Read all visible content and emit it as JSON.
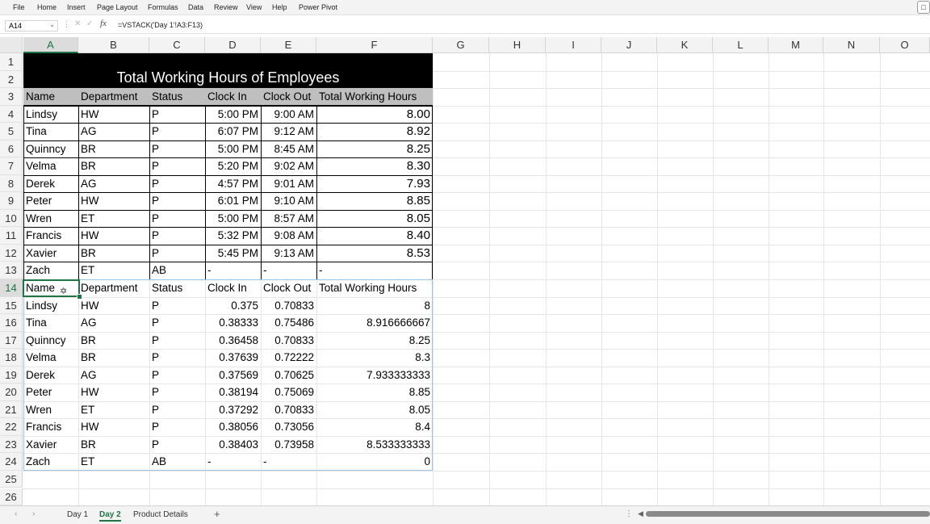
{
  "menu": [
    "File",
    "Home",
    "Insert",
    "Page Layout",
    "Formulas",
    "Data",
    "Review",
    "View",
    "Help",
    "Power Pivot"
  ],
  "formula_bar": {
    "name_box": "A14",
    "fx": "fx",
    "formula": "=VSTACK('Day 1'!A3:F13)"
  },
  "columns": [
    "A",
    "B",
    "C",
    "D",
    "E",
    "F",
    "G",
    "H",
    "I",
    "J",
    "K",
    "L",
    "M",
    "N",
    "O"
  ],
  "rows": [
    "1",
    "2",
    "3",
    "4",
    "5",
    "6",
    "7",
    "8",
    "9",
    "10",
    "11",
    "12",
    "13",
    "14",
    "15",
    "16",
    "17",
    "18",
    "19",
    "20",
    "21",
    "22",
    "23",
    "24",
    "25",
    "26"
  ],
  "title": "Total Working Hours of Employees",
  "headers": [
    "Name",
    "Department",
    "Status",
    "Clock In",
    "Clock Out",
    "Total Working Hours"
  ],
  "table1": [
    [
      "Lindsy",
      "HW",
      "P",
      "5:00 PM",
      "9:00 AM",
      "8.00"
    ],
    [
      "Tina",
      "AG",
      "P",
      "6:07 PM",
      "9:12 AM",
      "8.92"
    ],
    [
      "Quinncy",
      "BR",
      "P",
      "5:00 PM",
      "8:45 AM",
      "8.25"
    ],
    [
      "Velma",
      "BR",
      "P",
      "5:20 PM",
      "9:02 AM",
      "8.30"
    ],
    [
      "Derek",
      "AG",
      "P",
      "4:57 PM",
      "9:01 AM",
      "7.93"
    ],
    [
      "Peter",
      "HW",
      "P",
      "6:01 PM",
      "9:10 AM",
      "8.85"
    ],
    [
      "Wren",
      "ET",
      "P",
      "5:00 PM",
      "8:57 AM",
      "8.05"
    ],
    [
      "Francis",
      "HW",
      "P",
      "5:32 PM",
      "9:08 AM",
      "8.40"
    ],
    [
      "Xavier",
      "BR",
      "P",
      "5:45 PM",
      "9:13 AM",
      "8.53"
    ],
    [
      "Zach",
      "ET",
      "AB",
      "-",
      "-",
      "-"
    ]
  ],
  "table2_headers": [
    "Name",
    "Department",
    "Status",
    "Clock In",
    "Clock Out",
    "Total Working Hours"
  ],
  "table2": [
    [
      "Lindsy",
      "HW",
      "P",
      "0.375",
      "0.70833",
      "8"
    ],
    [
      "Tina",
      "AG",
      "P",
      "0.38333",
      "0.75486",
      "8.916666667"
    ],
    [
      "Quinncy",
      "BR",
      "P",
      "0.36458",
      "0.70833",
      "8.25"
    ],
    [
      "Velma",
      "BR",
      "P",
      "0.37639",
      "0.72222",
      "8.3"
    ],
    [
      "Derek",
      "AG",
      "P",
      "0.37569",
      "0.70625",
      "7.933333333"
    ],
    [
      "Peter",
      "HW",
      "P",
      "0.38194",
      "0.75069",
      "8.85"
    ],
    [
      "Wren",
      "ET",
      "P",
      "0.37292",
      "0.70833",
      "8.05"
    ],
    [
      "Francis",
      "HW",
      "P",
      "0.38056",
      "0.73056",
      "8.4"
    ],
    [
      "Xavier",
      "BR",
      "P",
      "0.38403",
      "0.73958",
      "8.533333333"
    ],
    [
      "Zach",
      "ET",
      "AB",
      "-",
      "-",
      "0"
    ]
  ],
  "sheet_tabs": [
    "Day 1",
    "Day 2",
    "Product Details"
  ],
  "active_tab": "Day 2",
  "add_tab": "+",
  "icons": {
    "comment": "comment-icon",
    "cursor": "move-cursor-icon"
  }
}
